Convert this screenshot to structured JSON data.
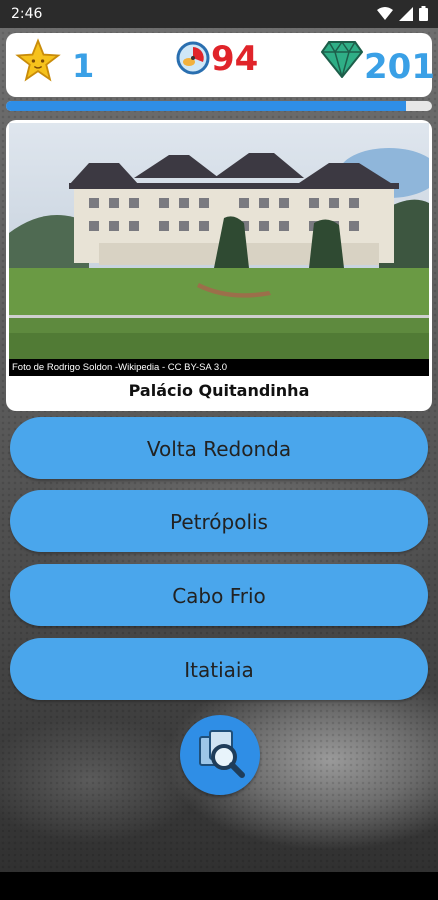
{
  "status_bar": {
    "time": "2:46",
    "wifi_icon": "wifi-icon",
    "signal_icon": "signal-icon",
    "battery_icon": "battery-icon"
  },
  "score": {
    "stars": "1",
    "timer": "94",
    "gems": "201",
    "icons": [
      "star-icon",
      "timer-icon",
      "gem-icon"
    ]
  },
  "progress": {
    "fraction": 0.94
  },
  "question": {
    "photo_credit": "Foto de Rodrigo Soldon -Wikipedia - CC BY-SA 3.0",
    "caption": "Palácio Quitandinha"
  },
  "answers": [
    "Volta Redonda",
    "Petrópolis",
    "Cabo Frio",
    "Itatiaia"
  ],
  "hint_button": {
    "icon": "magnifier-hint-icon"
  },
  "colors": {
    "accent": "#4aa6ec",
    "timer": "#e0242a",
    "count": "#3aa0e6"
  }
}
